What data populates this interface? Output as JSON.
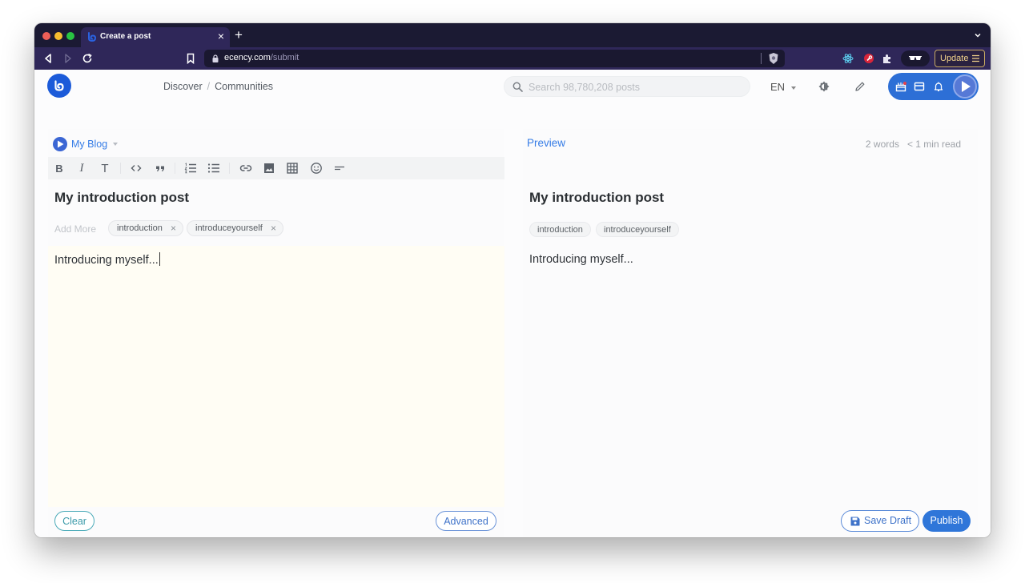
{
  "browser": {
    "tab": {
      "title": "Create a post"
    },
    "url": {
      "host": "ecency.com",
      "path": "/submit"
    },
    "update_label": "Update"
  },
  "header": {
    "breadcrumb": [
      "Discover",
      "Communities"
    ],
    "breadcrumb_separator": "/",
    "search_placeholder": "Search 98,780,208 posts",
    "language": "EN"
  },
  "editor": {
    "community": "My Blog",
    "toolbar": [
      {
        "icon": "bold-icon",
        "glyph": "B"
      },
      {
        "icon": "italic-icon",
        "glyph": "I"
      },
      {
        "icon": "heading-icon",
        "glyph": "T"
      },
      {
        "icon": "code-icon",
        "glyph": "<>"
      },
      {
        "icon": "quote-icon",
        "glyph": "❞"
      },
      {
        "icon": "ordered-list-icon",
        "glyph": "ol"
      },
      {
        "icon": "unordered-list-icon",
        "glyph": "ul"
      },
      {
        "icon": "link-icon",
        "glyph": "link"
      },
      {
        "icon": "image-icon",
        "glyph": "img"
      },
      {
        "icon": "table-icon",
        "glyph": "table"
      },
      {
        "icon": "emoji-icon",
        "glyph": "☺"
      },
      {
        "icon": "break-icon",
        "glyph": "—"
      }
    ],
    "title": "My introduction post",
    "tags_placeholder": "Add More",
    "tags": [
      "introduction",
      "introduceyourself"
    ],
    "body": "Introducing myself...",
    "clear_label": "Clear",
    "advanced_label": "Advanced"
  },
  "preview": {
    "label": "Preview",
    "word_count": "2 words",
    "read_time": "< 1 min read",
    "title": "My introduction post",
    "tags": [
      "introduction",
      "introduceyourself"
    ],
    "body": "Introducing myself...",
    "save_draft_label": "Save Draft",
    "publish_label": "Publish"
  },
  "colors": {
    "brand": "#1c5bd9",
    "accent": "#357ce6",
    "publish": "#2f76d9",
    "editor_bg": "#fffdf4"
  }
}
